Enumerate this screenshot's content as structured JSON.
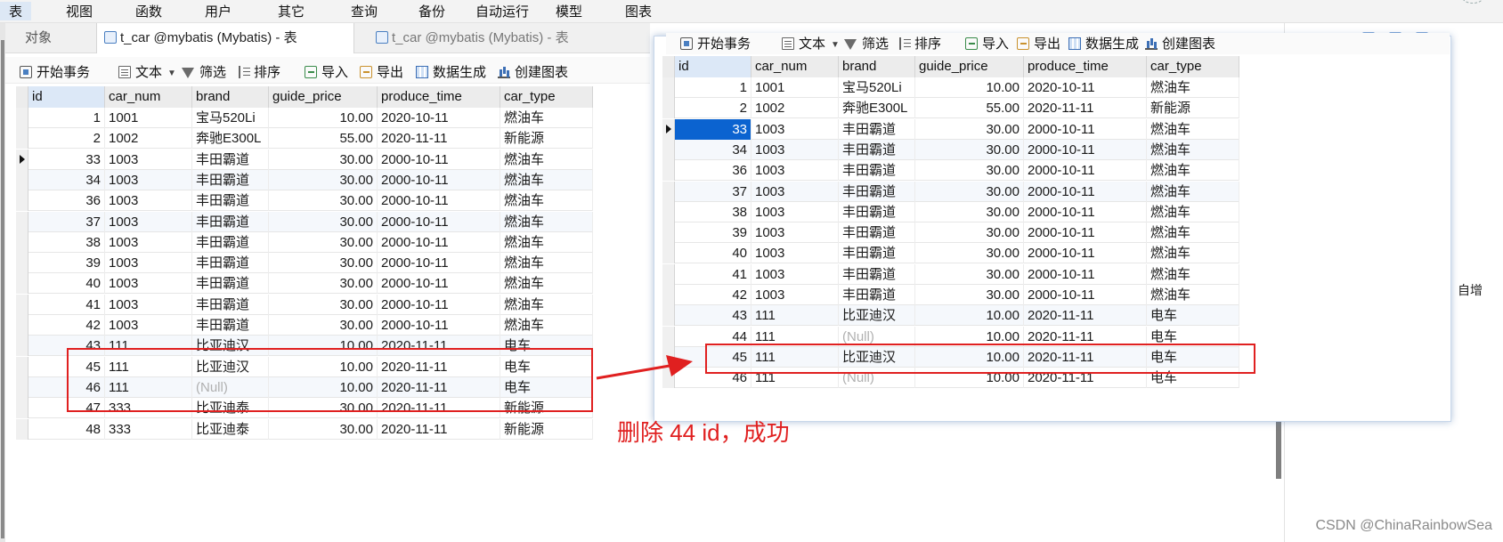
{
  "menu": {
    "items": [
      "表",
      "视图",
      "函数",
      "用户",
      "其它",
      "查询",
      "备份",
      "自动运行",
      "模型",
      "图表"
    ]
  },
  "tabs": {
    "objects": "对象",
    "tab1": "t_car @mybatis (Mybatis) - 表",
    "tab2": "t_car @mybatis (Mybatis) - 表"
  },
  "toolbar": {
    "begin_transaction": "开始事务",
    "text": "文本",
    "filter": "筛选",
    "sort": "排序",
    "import": "导入",
    "export": "导出",
    "data_generation": "数据生成",
    "create_chart": "创建图表"
  },
  "columns": [
    "id",
    "car_num",
    "brand",
    "guide_price",
    "produce_time",
    "car_type"
  ],
  "left_table": {
    "rows": [
      [
        "1",
        "1001",
        "宝马520Li",
        "10.00",
        "2020-10-11",
        "燃油车"
      ],
      [
        "2",
        "1002",
        "奔驰E300L",
        "55.00",
        "2020-11-11",
        "新能源"
      ],
      [
        "33",
        "1003",
        "丰田霸道",
        "30.00",
        "2000-10-11",
        "燃油车"
      ],
      [
        "34",
        "1003",
        "丰田霸道",
        "30.00",
        "2000-10-11",
        "燃油车"
      ],
      [
        "36",
        "1003",
        "丰田霸道",
        "30.00",
        "2000-10-11",
        "燃油车"
      ],
      [
        "37",
        "1003",
        "丰田霸道",
        "30.00",
        "2000-10-11",
        "燃油车"
      ],
      [
        "38",
        "1003",
        "丰田霸道",
        "30.00",
        "2000-10-11",
        "燃油车"
      ],
      [
        "39",
        "1003",
        "丰田霸道",
        "30.00",
        "2000-10-11",
        "燃油车"
      ],
      [
        "40",
        "1003",
        "丰田霸道",
        "30.00",
        "2000-10-11",
        "燃油车"
      ],
      [
        "41",
        "1003",
        "丰田霸道",
        "30.00",
        "2000-10-11",
        "燃油车"
      ],
      [
        "42",
        "1003",
        "丰田霸道",
        "30.00",
        "2000-10-11",
        "燃油车"
      ],
      [
        "43",
        "111",
        "比亚迪汉",
        "10.00",
        "2020-11-11",
        "电车"
      ],
      [
        "45",
        "111",
        "比亚迪汉",
        "10.00",
        "2020-11-11",
        "电车"
      ],
      [
        "46",
        "111",
        "(Null)",
        "10.00",
        "2020-11-11",
        "电车"
      ],
      [
        "47",
        "333",
        "比亚迪泰",
        "30.00",
        "2020-11-11",
        "新能源"
      ],
      [
        "48",
        "333",
        "比亚迪泰",
        "30.00",
        "2020-11-11",
        "新能源"
      ]
    ]
  },
  "right_table": {
    "rows": [
      [
        "1",
        "1001",
        "宝马520Li",
        "10.00",
        "2020-10-11",
        "燃油车"
      ],
      [
        "2",
        "1002",
        "奔驰E300L",
        "55.00",
        "2020-11-11",
        "新能源"
      ],
      [
        "33",
        "1003",
        "丰田霸道",
        "30.00",
        "2000-10-11",
        "燃油车"
      ],
      [
        "34",
        "1003",
        "丰田霸道",
        "30.00",
        "2000-10-11",
        "燃油车"
      ],
      [
        "36",
        "1003",
        "丰田霸道",
        "30.00",
        "2000-10-11",
        "燃油车"
      ],
      [
        "37",
        "1003",
        "丰田霸道",
        "30.00",
        "2000-10-11",
        "燃油车"
      ],
      [
        "38",
        "1003",
        "丰田霸道",
        "30.00",
        "2000-10-11",
        "燃油车"
      ],
      [
        "39",
        "1003",
        "丰田霸道",
        "30.00",
        "2000-10-11",
        "燃油车"
      ],
      [
        "40",
        "1003",
        "丰田霸道",
        "30.00",
        "2000-10-11",
        "燃油车"
      ],
      [
        "41",
        "1003",
        "丰田霸道",
        "30.00",
        "2000-10-11",
        "燃油车"
      ],
      [
        "42",
        "1003",
        "丰田霸道",
        "30.00",
        "2000-10-11",
        "燃油车"
      ],
      [
        "43",
        "111",
        "比亚迪汉",
        "10.00",
        "2020-11-11",
        "电车"
      ],
      [
        "44",
        "111",
        "(Null)",
        "10.00",
        "2020-11-11",
        "电车"
      ],
      [
        "45",
        "111",
        "比亚迪汉",
        "10.00",
        "2020-11-11",
        "电车"
      ],
      [
        "46",
        "111",
        "(Null)",
        "10.00",
        "2020-11-11",
        "电车"
      ]
    ]
  },
  "side": {
    "auto_increment": "自增"
  },
  "annotation": {
    "text": "删除 44 id，成功"
  },
  "watermark": "CSDN @ChinaRainbowSea",
  "colors": {
    "highlight_red": "#e02020",
    "selection_blue": "#0b63d0",
    "null_gray": "#b0b0b0"
  },
  "icons": {
    "begin_transaction": "transaction-icon",
    "text": "text-icon",
    "filter": "filter-icon",
    "sort": "sort-icon",
    "import": "import-icon",
    "export": "export-icon",
    "data_generation": "data-generation-icon",
    "create_chart": "chart-icon"
  }
}
